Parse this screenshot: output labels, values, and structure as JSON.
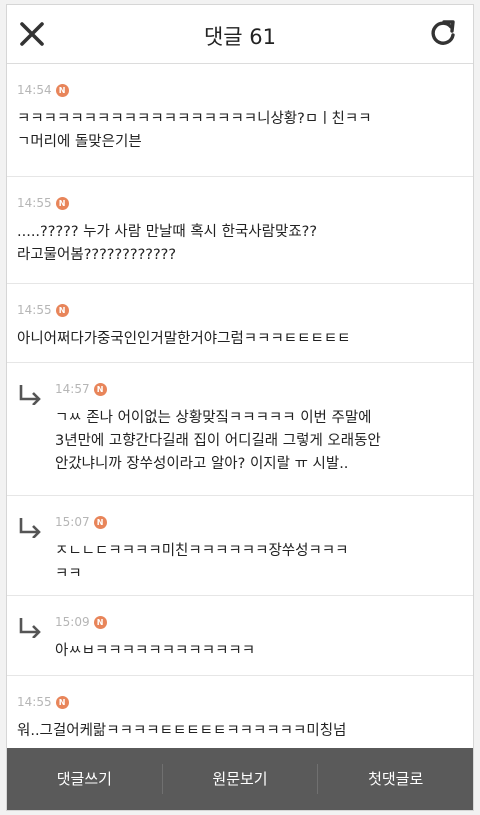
{
  "header": {
    "title": "댓글 61",
    "close_icon": "close-icon",
    "refresh_icon": "refresh-icon"
  },
  "badge_letter": "N",
  "comments": [
    {
      "time": "14:54",
      "text": "ㅋㅋㅋㅋㅋㅋㅋㅋㅋㅋㅋㅋㅋㅋㅋㅋㅋㅋ니상황?ㅁㅣ친ㅋㅋ\nㄱ머리에 돌맞은기븐"
    },
    {
      "time": "14:55",
      "text": ".....????? 누가 사람 만날때 혹시 한국사람맞죠??\n라고물어봄????????????"
    },
    {
      "time": "14:55",
      "text": "아니어쩌다가중국인인거말한거야그럼ㅋㅋㅋㅌㅌㅌㅌㅌ"
    },
    {
      "time": "14:57",
      "text": "ㄱㅆ 존나 어이없는 상황맞짘ㅋㅋㅋㅋㅋ 이번 주말에\n3년만에 고향간다길래 집이 어디길래 그렇게 오래동안\n안갔냐니까 장쑤성이라고 알아? 이지랄 ㅠ 시발.."
    },
    {
      "time": "15:07",
      "text": "ㅈㄴㄴㄷㅋㅋㅋㅋ미친ㅋㅋㅋㅋㅋㅋ장쑤성ㅋㅋㅋ\nㅋㅋ"
    },
    {
      "time": "15:09",
      "text": "아ㅆㅂㅋㅋㅋㅋㅋㅋㅋㅋㅋㅋㅋㅋ"
    },
    {
      "time": "14:55",
      "text": "워..그걸어케랆ㅋㅋㅋㅋㅌㅌㅌㅌㅌㅋㅋㅋㅋㅋㅋ미칭넘"
    }
  ],
  "footer": {
    "write_label": "댓글쓰기",
    "original_label": "원문보기",
    "first_label": "첫댓글로"
  },
  "colors": {
    "badge": "#e8855a",
    "bottom_bar": "#5a5a5a",
    "time_text": "#b6b6b6"
  }
}
